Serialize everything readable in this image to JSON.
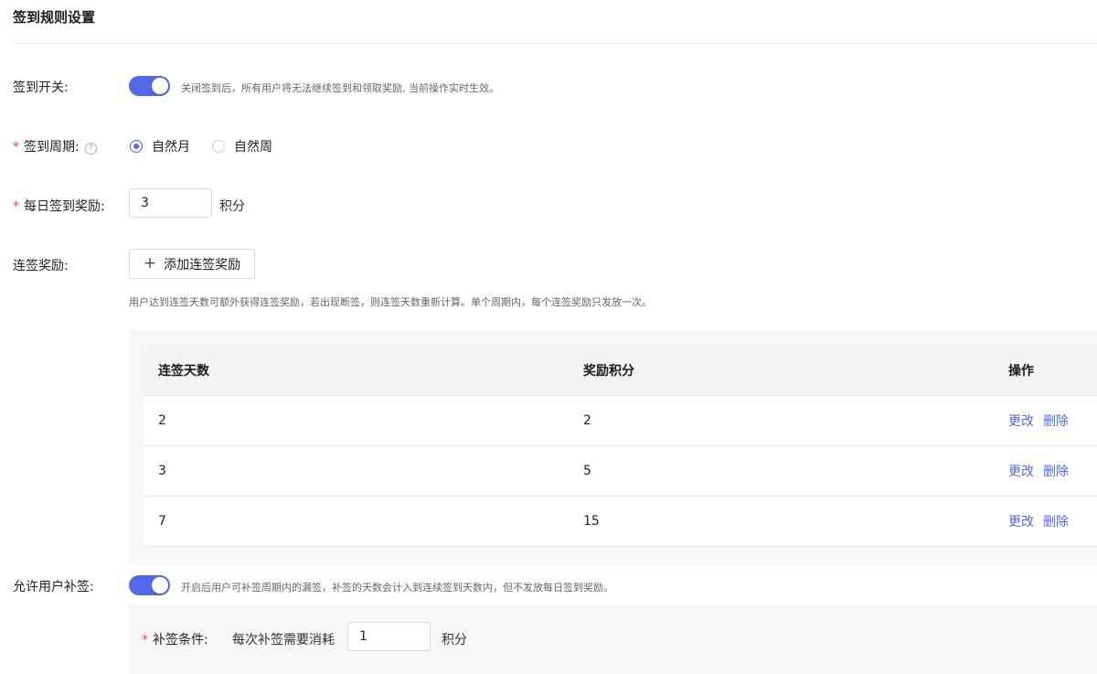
{
  "page": {
    "title": "签到规则设置"
  },
  "signin_switch": {
    "label": "签到开关",
    "on": true,
    "hint": "关闭签到后，所有用户将无法继续签到和领取奖励, 当前操作实时生效。"
  },
  "cycle": {
    "label": "签到周期",
    "help": "?",
    "options": [
      {
        "label": "自然月",
        "checked": true
      },
      {
        "label": "自然周",
        "checked": false
      }
    ]
  },
  "daily_reward": {
    "label": "每日签到奖励",
    "value": "3",
    "unit": "积分"
  },
  "streak": {
    "label": "连签奖励",
    "add_button": "添加连签奖励",
    "hint": "用户达到连签天数可额外获得连签奖励，若出现断签，则连签天数重新计算。单个周期内，每个连签奖励只发放一次。",
    "columns": [
      "连签天数",
      "奖励积分",
      "操作"
    ],
    "rows": [
      {
        "days": "2",
        "points": "2",
        "edit": "更改",
        "delete": "删除"
      },
      {
        "days": "3",
        "points": "5",
        "edit": "更改",
        "delete": "删除"
      },
      {
        "days": "7",
        "points": "15",
        "edit": "更改",
        "delete": "删除"
      }
    ]
  },
  "makeup": {
    "label": "允许用户补签",
    "on": true,
    "hint": "开启后用户可补签周期内的漏签，补签的天数会计入到连续签到天数内，但不发放每日签到奖励。",
    "condition_label": "补签条件",
    "condition_text": "每次补签需要消耗",
    "value": "1",
    "unit": "积分"
  },
  "colors": {
    "accent": "#5367e8",
    "required": "#e5484d"
  }
}
